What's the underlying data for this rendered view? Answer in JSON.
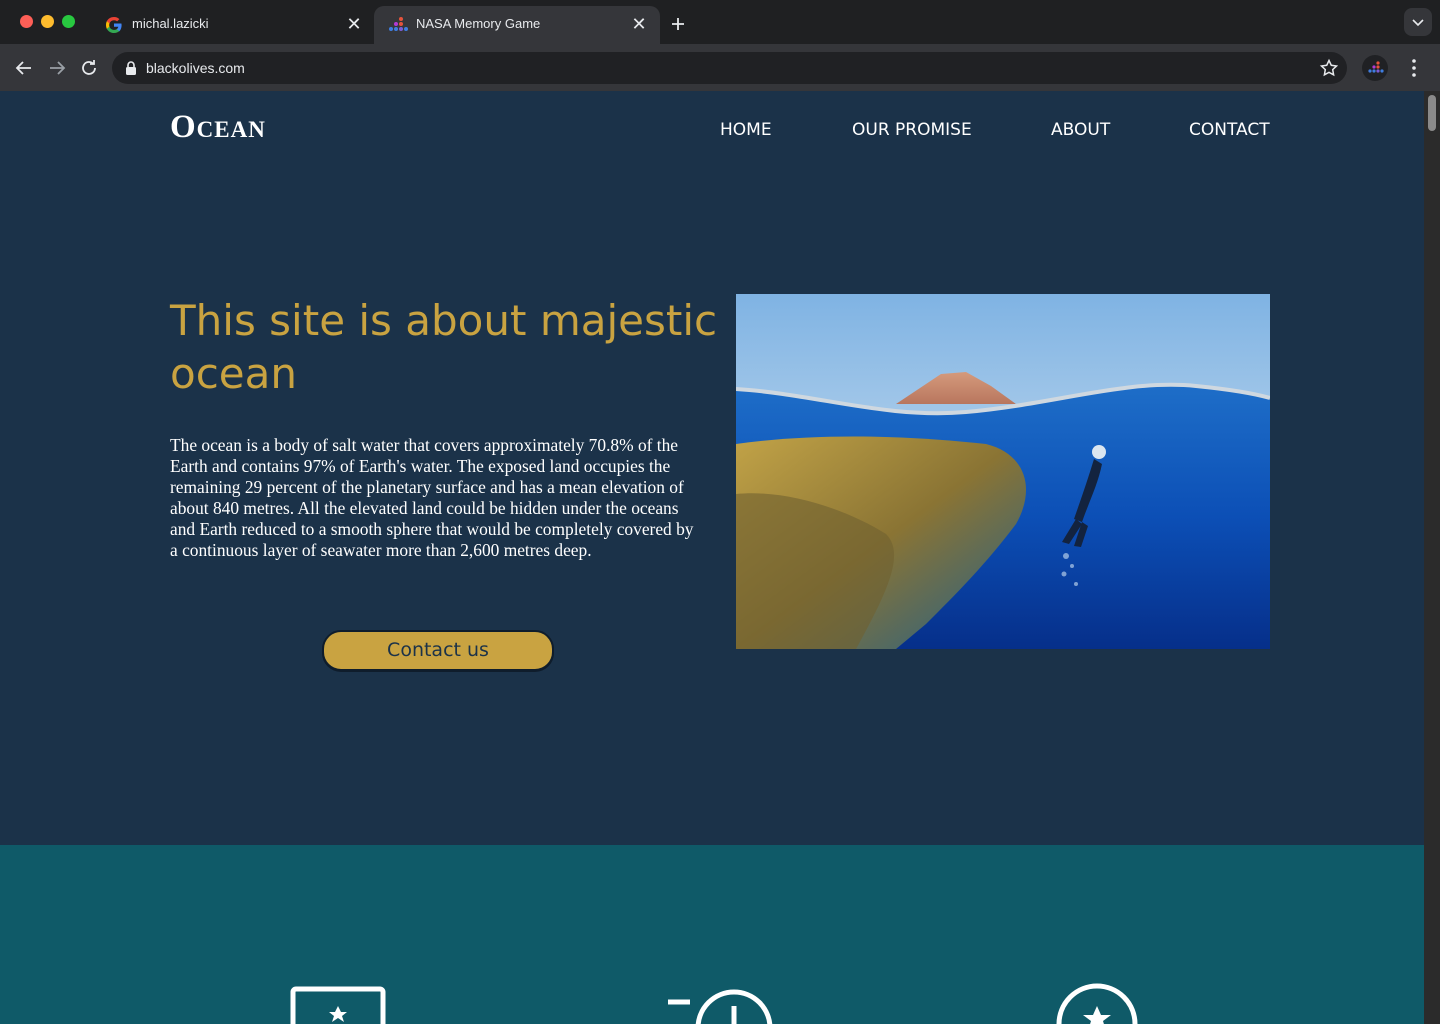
{
  "browser": {
    "tabs": [
      {
        "title": "michal.lazicki",
        "favicon": "google-g-icon",
        "active": false
      },
      {
        "title": "NASA Memory Game",
        "favicon": "dots-app-icon",
        "active": true
      }
    ],
    "address": "blackolives.com",
    "icons": {
      "back": "arrow-left-icon",
      "forward": "arrow-right-icon",
      "reload": "reload-icon",
      "lock": "lock-icon",
      "bookmark": "star-icon",
      "menu": "kebab-menu-icon",
      "new_tab": "plus-icon",
      "tab_search": "chevron-down-icon"
    }
  },
  "site": {
    "logo": "Ocean",
    "nav": [
      "HOME",
      "OUR PROMISE",
      "ABOUT",
      "CONTACT"
    ],
    "hero": {
      "title": "This site is about majestic ocean",
      "body": "The ocean is a body of salt water that covers approximately 70.8% of the Earth and contains 97% of Earth's water. The exposed land occupies the remaining 29 percent of the planetary surface and has a mean elevation of about 840 metres. All the elevated land could be hidden under the oceans and Earth reduced to a smooth sphere that would be completely covered by a continuous layer of seawater more than 2,600 metres deep.",
      "cta": "Contact us",
      "image": "ocean-diver-photo"
    },
    "features": {
      "icons": [
        "image-frame-icon",
        "clock-icon",
        "star-circle-icon"
      ]
    },
    "colors": {
      "background": "#1b3249",
      "accent": "#c9a341",
      "features_bg": "#0f5a68",
      "text": "#ffffff"
    }
  }
}
